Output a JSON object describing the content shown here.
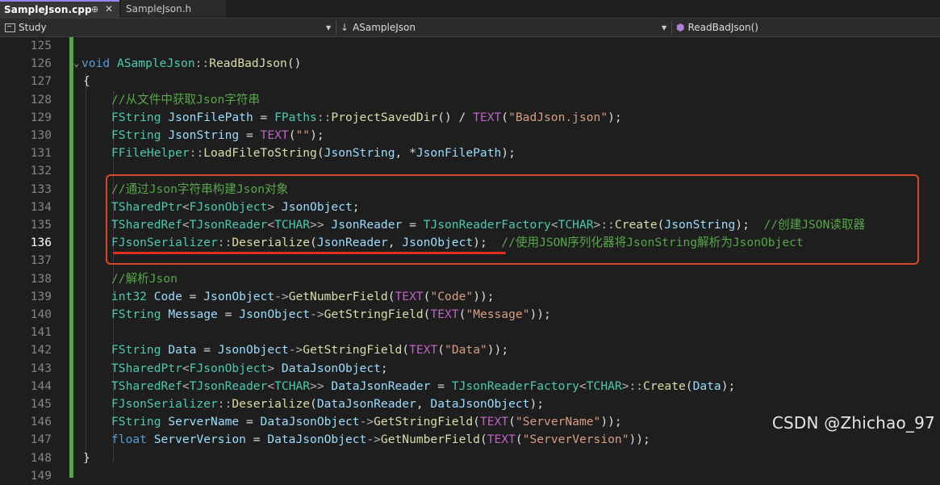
{
  "tabs": {
    "active": {
      "label": "SampleJson.cpp",
      "pin_glyph": "⊕",
      "close_glyph": "✕"
    },
    "inactive": {
      "label": "SampleJson.h"
    }
  },
  "navbar": {
    "project": "Study",
    "class_scope": "ASampleJson",
    "member": "ReadBadJson()"
  },
  "editor": {
    "current_line": "136",
    "lines": [
      {
        "n": "125"
      },
      {
        "n": "126"
      },
      {
        "n": "127"
      },
      {
        "n": "128"
      },
      {
        "n": "129"
      },
      {
        "n": "130"
      },
      {
        "n": "131"
      },
      {
        "n": "132"
      },
      {
        "n": "133"
      },
      {
        "n": "134"
      },
      {
        "n": "135"
      },
      {
        "n": "136"
      },
      {
        "n": "137"
      },
      {
        "n": "138"
      },
      {
        "n": "139"
      },
      {
        "n": "140"
      },
      {
        "n": "141"
      },
      {
        "n": "142"
      },
      {
        "n": "143"
      },
      {
        "n": "144"
      },
      {
        "n": "145"
      },
      {
        "n": "146"
      },
      {
        "n": "147"
      },
      {
        "n": "148"
      },
      {
        "n": "149"
      }
    ],
    "code": {
      "l126": [
        [
          "kw",
          "void"
        ],
        [
          "pl",
          " "
        ],
        [
          "ty",
          "ASampleJson"
        ],
        [
          "op",
          "::"
        ],
        [
          "fn",
          "ReadBadJson"
        ],
        [
          "pl",
          "()"
        ]
      ],
      "l127": [
        [
          "pl",
          "{"
        ]
      ],
      "l128": [
        [
          "cm",
          "//从文件中获取Json字符串"
        ]
      ],
      "l129": [
        [
          "ty",
          "FString"
        ],
        [
          "pl",
          " "
        ],
        [
          "var",
          "JsonFilePath"
        ],
        [
          "pl",
          " = "
        ],
        [
          "ty",
          "FPaths"
        ],
        [
          "op",
          "::"
        ],
        [
          "fn",
          "ProjectSavedDir"
        ],
        [
          "pl",
          "() / "
        ],
        [
          "mac",
          "TEXT"
        ],
        [
          "pl",
          "("
        ],
        [
          "str",
          "\"BadJson.json\""
        ],
        [
          "pl",
          ");"
        ]
      ],
      "l130": [
        [
          "ty",
          "FString"
        ],
        [
          "pl",
          " "
        ],
        [
          "var",
          "JsonString"
        ],
        [
          "pl",
          " = "
        ],
        [
          "mac",
          "TEXT"
        ],
        [
          "pl",
          "("
        ],
        [
          "str",
          "\"\""
        ],
        [
          "pl",
          ");"
        ]
      ],
      "l131": [
        [
          "ty",
          "FFileHelper"
        ],
        [
          "op",
          "::"
        ],
        [
          "fn",
          "LoadFileToString"
        ],
        [
          "pl",
          "("
        ],
        [
          "var",
          "JsonString"
        ],
        [
          "pl",
          ", *"
        ],
        [
          "var",
          "JsonFilePath"
        ],
        [
          "pl",
          ");"
        ]
      ],
      "l133": [
        [
          "cm",
          "//通过Json字符串构建Json对象"
        ]
      ],
      "l134": [
        [
          "ty",
          "TSharedPtr"
        ],
        [
          "op",
          "<"
        ],
        [
          "ty",
          "FJsonObject"
        ],
        [
          "op",
          "> "
        ],
        [
          "var",
          "JsonObject"
        ],
        [
          "pl",
          ";"
        ]
      ],
      "l135": [
        [
          "ty",
          "TSharedRef"
        ],
        [
          "op",
          "<"
        ],
        [
          "ty",
          "TJsonReader"
        ],
        [
          "op",
          "<"
        ],
        [
          "ty",
          "TCHAR"
        ],
        [
          "op",
          ">> "
        ],
        [
          "var",
          "JsonReader"
        ],
        [
          "pl",
          " = "
        ],
        [
          "ty",
          "TJsonReaderFactory"
        ],
        [
          "op",
          "<"
        ],
        [
          "ty",
          "TCHAR"
        ],
        [
          "op",
          ">::"
        ],
        [
          "fn",
          "Create"
        ],
        [
          "pl",
          "("
        ],
        [
          "var",
          "JsonString"
        ],
        [
          "pl",
          ");  "
        ],
        [
          "cm",
          "//创建JSON读取器"
        ]
      ],
      "l136": [
        [
          "ty",
          "FJsonSerializer"
        ],
        [
          "op",
          "::"
        ],
        [
          "fn",
          "Deserialize"
        ],
        [
          "pl",
          "("
        ],
        [
          "var",
          "JsonReader"
        ],
        [
          "pl",
          ", "
        ],
        [
          "var",
          "JsonObject"
        ],
        [
          "pl",
          ");  "
        ],
        [
          "cm",
          "//使用JSON序列化器将JsonString解析为JsonObject"
        ]
      ],
      "l138": [
        [
          "cm",
          "//解析Json"
        ]
      ],
      "l139": [
        [
          "ty",
          "int32"
        ],
        [
          "pl",
          " "
        ],
        [
          "var",
          "Code"
        ],
        [
          "pl",
          " = "
        ],
        [
          "var",
          "JsonObject"
        ],
        [
          "op",
          "->"
        ],
        [
          "fn",
          "GetNumberField"
        ],
        [
          "pl",
          "("
        ],
        [
          "mac",
          "TEXT"
        ],
        [
          "pl",
          "("
        ],
        [
          "str",
          "\"Code\""
        ],
        [
          "pl",
          "));"
        ]
      ],
      "l140": [
        [
          "ty",
          "FString"
        ],
        [
          "pl",
          " "
        ],
        [
          "var",
          "Message"
        ],
        [
          "pl",
          " = "
        ],
        [
          "var",
          "JsonObject"
        ],
        [
          "op",
          "->"
        ],
        [
          "fn",
          "GetStringField"
        ],
        [
          "pl",
          "("
        ],
        [
          "mac",
          "TEXT"
        ],
        [
          "pl",
          "("
        ],
        [
          "str",
          "\"Message\""
        ],
        [
          "pl",
          "));"
        ]
      ],
      "l142": [
        [
          "ty",
          "FString"
        ],
        [
          "pl",
          " "
        ],
        [
          "var",
          "Data"
        ],
        [
          "pl",
          " = "
        ],
        [
          "var",
          "JsonObject"
        ],
        [
          "op",
          "->"
        ],
        [
          "fn",
          "GetStringField"
        ],
        [
          "pl",
          "("
        ],
        [
          "mac",
          "TEXT"
        ],
        [
          "pl",
          "("
        ],
        [
          "str",
          "\"Data\""
        ],
        [
          "pl",
          "));"
        ]
      ],
      "l143": [
        [
          "ty",
          "TSharedPtr"
        ],
        [
          "op",
          "<"
        ],
        [
          "ty",
          "FJsonObject"
        ],
        [
          "op",
          "> "
        ],
        [
          "var",
          "DataJsonObject"
        ],
        [
          "pl",
          ";"
        ]
      ],
      "l144": [
        [
          "ty",
          "TSharedRef"
        ],
        [
          "op",
          "<"
        ],
        [
          "ty",
          "TJsonReader"
        ],
        [
          "op",
          "<"
        ],
        [
          "ty",
          "TCHAR"
        ],
        [
          "op",
          ">> "
        ],
        [
          "var",
          "DataJsonReader"
        ],
        [
          "pl",
          " = "
        ],
        [
          "ty",
          "TJsonReaderFactory"
        ],
        [
          "op",
          "<"
        ],
        [
          "ty",
          "TCHAR"
        ],
        [
          "op",
          ">::"
        ],
        [
          "fn",
          "Create"
        ],
        [
          "pl",
          "("
        ],
        [
          "var",
          "Data"
        ],
        [
          "pl",
          ");"
        ]
      ],
      "l145": [
        [
          "ty",
          "FJsonSerializer"
        ],
        [
          "op",
          "::"
        ],
        [
          "fn",
          "Deserialize"
        ],
        [
          "pl",
          "("
        ],
        [
          "var",
          "DataJsonReader"
        ],
        [
          "pl",
          ", "
        ],
        [
          "var",
          "DataJsonObject"
        ],
        [
          "pl",
          ");"
        ]
      ],
      "l146": [
        [
          "ty",
          "FString"
        ],
        [
          "pl",
          " "
        ],
        [
          "var",
          "ServerName"
        ],
        [
          "pl",
          " = "
        ],
        [
          "var",
          "DataJsonObject"
        ],
        [
          "op",
          "->"
        ],
        [
          "fn",
          "GetStringField"
        ],
        [
          "pl",
          "("
        ],
        [
          "mac",
          "TEXT"
        ],
        [
          "pl",
          "("
        ],
        [
          "str",
          "\"ServerName\""
        ],
        [
          "pl",
          "));"
        ]
      ],
      "l147": [
        [
          "kw",
          "float"
        ],
        [
          "pl",
          " "
        ],
        [
          "var",
          "ServerVersion"
        ],
        [
          "pl",
          " = "
        ],
        [
          "var",
          "DataJsonObject"
        ],
        [
          "op",
          "->"
        ],
        [
          "fn",
          "GetNumberField"
        ],
        [
          "pl",
          "("
        ],
        [
          "mac",
          "TEXT"
        ],
        [
          "pl",
          "("
        ],
        [
          "str",
          "\"ServerVersion\""
        ],
        [
          "pl",
          "));"
        ]
      ],
      "l148": [
        [
          "pl",
          "}"
        ]
      ]
    }
  },
  "watermark": "CSDN @Zhichao_97",
  "colors": {
    "keyword": "#569cd6",
    "type": "#4ec9b0",
    "function": "#dcdcaa",
    "variable": "#9cdcfe",
    "string": "#d69d85",
    "macro": "#bd63c5",
    "comment": "#57a64a",
    "highlight_box": "#d9482b",
    "change_bar": "#56a64b"
  }
}
